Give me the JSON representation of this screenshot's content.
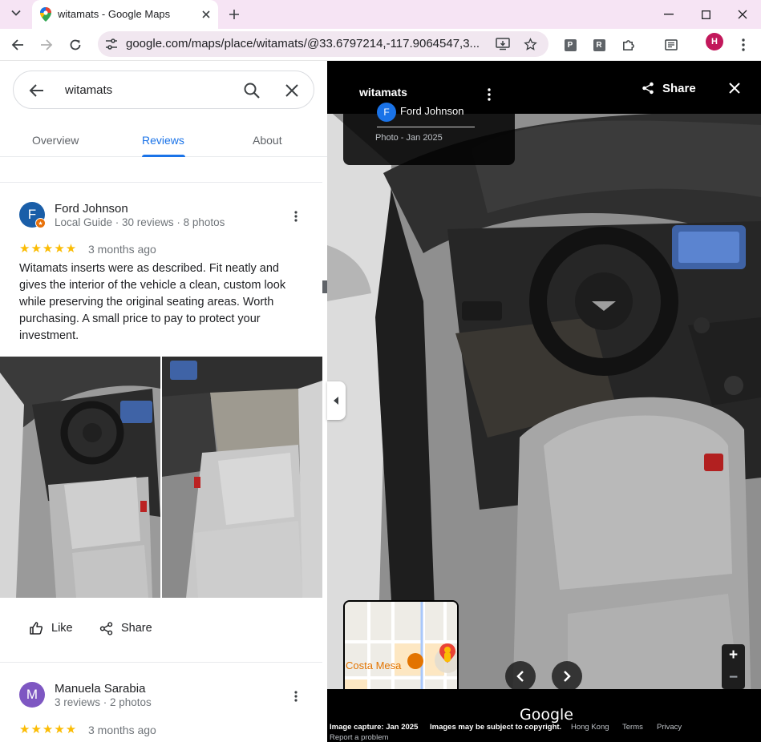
{
  "browser": {
    "tab_title": "witamats - Google Maps",
    "url": "google.com/maps/place/witamats/@33.6797214,-117.9064547,3...",
    "profile_initial": "H",
    "extensions": [
      "P",
      "R"
    ]
  },
  "panel": {
    "search_value": "witamats",
    "tabs": [
      {
        "label": "Overview",
        "active": false
      },
      {
        "label": "Reviews",
        "active": true
      },
      {
        "label": "About",
        "active": false
      }
    ]
  },
  "reviews": [
    {
      "initial": "F",
      "avatar_color": "#1a5ea8",
      "name": "Ford Johnson",
      "meta": "Local Guide · 30 reviews · 8 photos",
      "stars": "★★★★★",
      "rating": 5,
      "date": "3 months ago",
      "text": "Witamats inserts were as described. Fit neatly and gives the interior of the vehicle a clean, custom look while preserving the original seating areas. Worth purchasing. A small price to pay to protect your investment.",
      "actions": {
        "like": "Like",
        "share": "Share"
      }
    },
    {
      "initial": "M",
      "avatar_color": "#7e57c2",
      "name": "Manuela Sarabia",
      "meta": "3 reviews · 2 photos",
      "stars": "★★★★★",
      "rating": 5,
      "date": "3 months ago"
    }
  ],
  "viewer": {
    "title": "witamats",
    "author_initial": "F",
    "author": "Ford Johnson",
    "photo_date": "Photo - Jan 2025",
    "share_label": "Share",
    "map_label": "Costa Mesa",
    "zoom_in": "+",
    "zoom_out": "−",
    "logo": "Google",
    "footer": {
      "capture": "Image capture: Jan 2025",
      "copyright": "Images may be subject to copyright.",
      "region": "Hong Kong",
      "terms": "Terms",
      "privacy": "Privacy",
      "report": "Report a problem"
    }
  }
}
